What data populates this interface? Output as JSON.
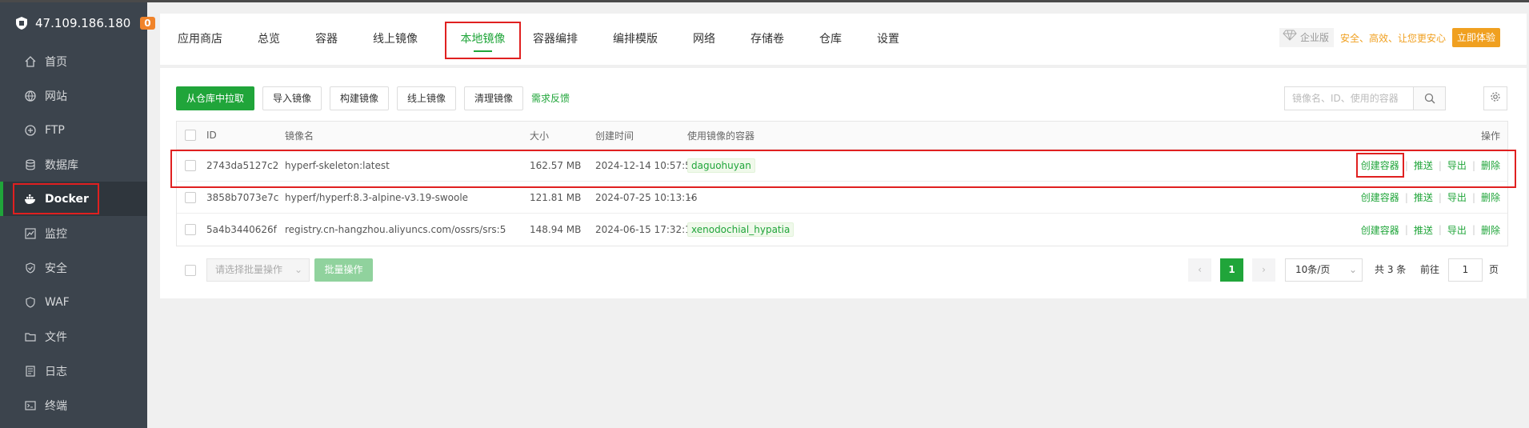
{
  "sidebar": {
    "host": "47.109.186.180",
    "badge": "0",
    "items": [
      {
        "label": "首页",
        "icon": "home-icon"
      },
      {
        "label": "网站",
        "icon": "globe-icon"
      },
      {
        "label": "FTP",
        "icon": "ftp-icon"
      },
      {
        "label": "数据库",
        "icon": "database-icon"
      },
      {
        "label": "Docker",
        "icon": "docker-icon",
        "active": true
      },
      {
        "label": "监控",
        "icon": "monitor-icon"
      },
      {
        "label": "安全",
        "icon": "shield-icon"
      },
      {
        "label": "WAF",
        "icon": "waf-icon"
      },
      {
        "label": "文件",
        "icon": "folder-icon"
      },
      {
        "label": "日志",
        "icon": "log-icon"
      },
      {
        "label": "终端",
        "icon": "terminal-icon"
      }
    ]
  },
  "tabs": [
    "应用商店",
    "总览",
    "容器",
    "线上镜像",
    "本地镜像",
    "容器编排",
    "编排模版",
    "网络",
    "存储卷",
    "仓库",
    "设置"
  ],
  "active_tab": "本地镜像",
  "promo": {
    "edition": "企业版",
    "text": "安全、高效、让您更安心",
    "button": "立即体验"
  },
  "toolbar": {
    "pull": "从仓库中拉取",
    "import": "导入镜像",
    "build": "构建镜像",
    "online": "线上镜像",
    "clean": "清理镜像",
    "feedback": "需求反馈",
    "search_placeholder": "镜像名、ID、使用的容器"
  },
  "table": {
    "headers": {
      "id": "ID",
      "name": "镜像名",
      "size": "大小",
      "created": "创建时间",
      "containers": "使用镜像的容器",
      "ops": "操作"
    },
    "rows": [
      {
        "id": "2743da5127c2",
        "name": "hyperf-skeleton:latest",
        "size": "162.57 MB",
        "created": "2024-12-14 10:57:50",
        "container": "daguohuyan"
      },
      {
        "id": "3858b7073e7c",
        "name": "hyperf/hyperf:8.3-alpine-v3.19-swoole",
        "size": "121.81 MB",
        "created": "2024-07-25 10:13:16",
        "container": "--"
      },
      {
        "id": "5a4b3440626f",
        "name": "registry.cn-hangzhou.aliyuncs.com/ossrs/srs:5",
        "size": "148.94 MB",
        "created": "2024-06-15 17:32:18",
        "container": "xenodochial_hypatia"
      }
    ],
    "ops": {
      "create": "创建容器",
      "push": "推送",
      "export": "导出",
      "delete": "删除"
    }
  },
  "footer": {
    "batch_placeholder": "请选择批量操作",
    "batch_button": "批量操作",
    "current_page": "1",
    "page_size": "10条/页",
    "total": "共 3 条",
    "goto_label": "前往",
    "goto_value": "1",
    "page_unit": "页"
  }
}
